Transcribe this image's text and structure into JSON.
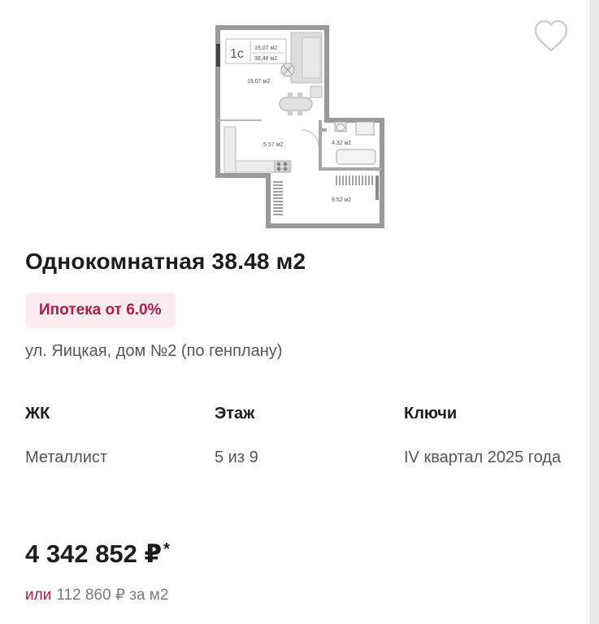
{
  "listing": {
    "plan": {
      "type_label": "1с",
      "area_living": "19,07 м2",
      "area_total": "38,48 м2",
      "room_main": "19.07 м2",
      "room_kitchen": "5.57 м2",
      "room_bath": "4.32 м2",
      "room_balcony": "9.52 м2"
    },
    "title": "Однокомнатная 38.48 м2",
    "mortgage_badge": "Ипотека от 6.0%",
    "address": "ул. Яицкая, дом №2 (по генплану)",
    "details": [
      {
        "label": "ЖК",
        "value": "Металлист"
      },
      {
        "label": "Этаж",
        "value": "5 из 9"
      },
      {
        "label": "Ключи",
        "value": "IV квартал 2025 года"
      }
    ],
    "price": "4 342 852 ₽",
    "price_mark": "*",
    "per_meter_prefix": "или",
    "per_meter": "112 860 ₽ за м2"
  },
  "icons": {
    "favorite": "heart-outline-icon"
  },
  "colors": {
    "accent": "#b21c48",
    "badge_bg": "#fbecef",
    "secondary_text": "#555555"
  }
}
